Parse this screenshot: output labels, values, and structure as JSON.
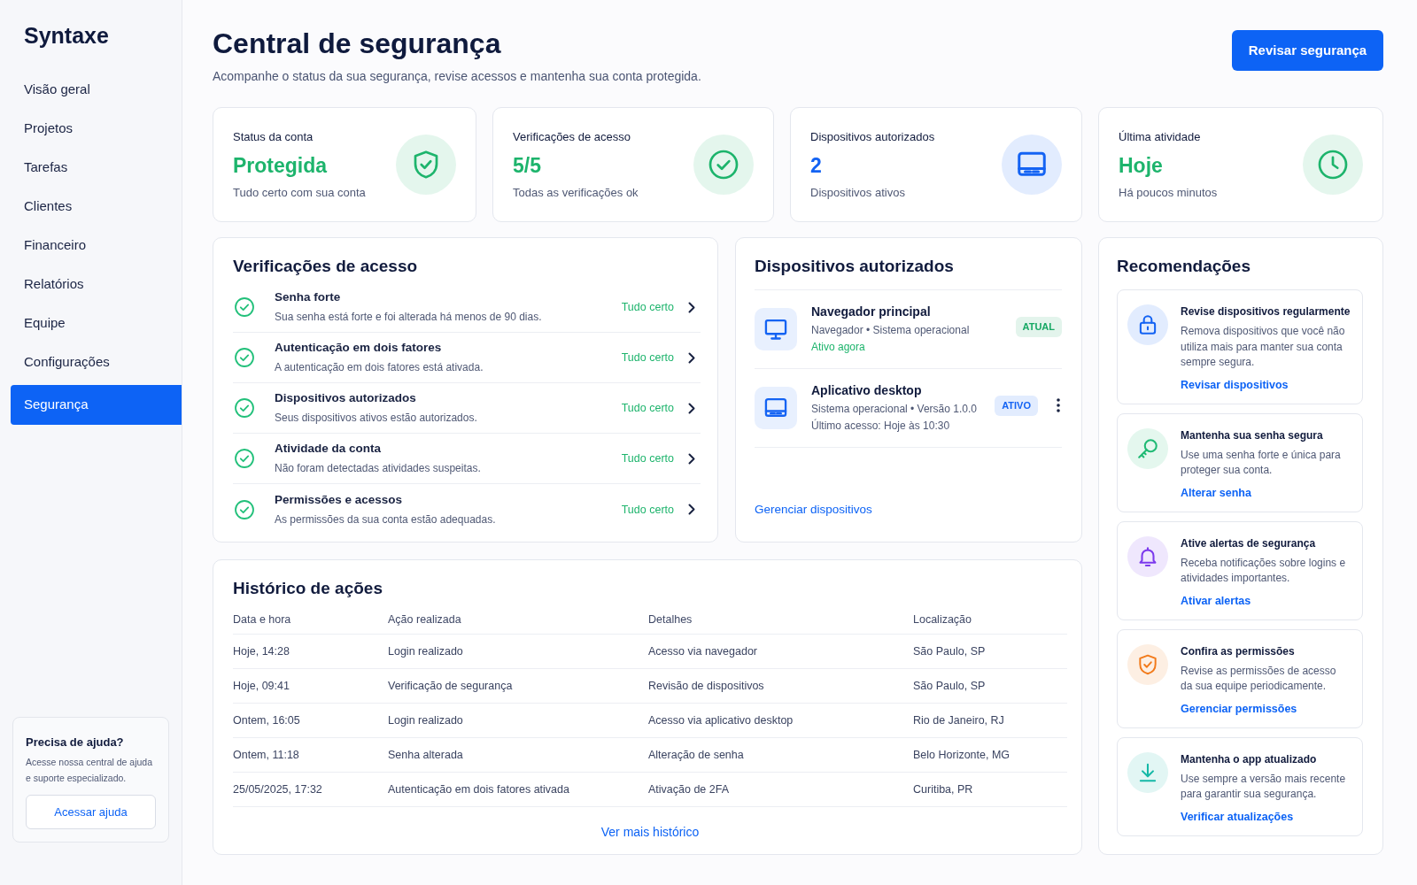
{
  "sidebar": {
    "logo": "Syntaxe",
    "items": [
      {
        "label": "Visão geral",
        "selected": false
      },
      {
        "label": "Projetos",
        "selected": false
      },
      {
        "label": "Tarefas",
        "selected": false
      },
      {
        "label": "Clientes",
        "selected": false
      },
      {
        "label": "Financeiro",
        "selected": false
      },
      {
        "label": "Relatórios",
        "selected": false
      },
      {
        "label": "Equipe",
        "selected": false
      },
      {
        "label": "Configurações",
        "selected": false
      },
      {
        "label": "Segurança",
        "selected": true
      }
    ],
    "help": {
      "title": "Precisa de ajuda?",
      "text": "Acesse nossa central de ajuda e suporte especializado.",
      "button": "Acessar ajuda"
    }
  },
  "header": {
    "title": "Central de segurança",
    "subtitle": "Acompanhe o status da sua segurança, revise acessos e mantenha sua conta protegida.",
    "button": "Revisar segurança"
  },
  "stats": [
    {
      "kind": "status",
      "label": "Status da conta",
      "value": "Protegida",
      "caption": "Tudo certo com sua conta",
      "color": "#1db46c"
    },
    {
      "kind": "checks",
      "label": "Verificações de acesso",
      "value": "5/5",
      "caption": "Todas as verificações ok",
      "color": "#1db46c"
    },
    {
      "kind": "devices",
      "label": "Dispositivos autorizados",
      "value": "2",
      "caption": "Dispositivos ativos",
      "color": "#1463f3"
    },
    {
      "kind": "activity",
      "label": "Última atividade",
      "value": "Hoje",
      "caption": "Há poucos minutos",
      "color": "#1db46c"
    }
  ],
  "access_checks": {
    "title": "Verificações de acesso",
    "items": [
      {
        "title": "Senha forte",
        "description": "Sua senha está forte e foi alterada há menos de 90 dias.",
        "status": "Tudo certo",
        "ok": true
      },
      {
        "title": "Autenticação em dois fatores",
        "description": "A autenticação em dois fatores está ativada.",
        "status": "Tudo certo",
        "ok": true
      },
      {
        "title": "Dispositivos autorizados",
        "description": "Seus dispositivos ativos estão autorizados.",
        "status": "Tudo certo",
        "ok": true
      },
      {
        "title": "Atividade da conta",
        "description": "Não foram detectadas atividades suspeitas.",
        "status": "Tudo certo",
        "ok": true
      },
      {
        "title": "Permissões e acessos",
        "description": "As permissões da sua conta estão adequadas.",
        "status": "Tudo certo",
        "ok": true
      }
    ]
  },
  "devices": {
    "title": "Dispositivos autorizados",
    "items": [
      {
        "kind": "browser",
        "name": "Navegador principal",
        "details": "Navegador • Sistema operacional",
        "status": {
          "text": "Ativo agora",
          "online": true
        },
        "badge": {
          "text": "ATUAL",
          "color": "#16a864"
        },
        "menu": false
      },
      {
        "kind": "desktop",
        "name": "Aplicativo desktop",
        "details": "Sistema operacional • Versão 1.0.0",
        "status": {
          "text": "Último acesso: Hoje às 10:30",
          "online": false
        },
        "badge": {
          "text": "ATIVO",
          "color": "#1463f3"
        },
        "menu": true
      }
    ],
    "link": "Gerenciar dispositivos"
  },
  "history": {
    "title": "Histórico de ações",
    "columns": [
      "Data e hora",
      "Ação realizada",
      "Detalhes",
      "Localização"
    ],
    "rows": [
      [
        "Hoje, 14:28",
        "Login realizado",
        "Acesso via navegador",
        "São Paulo, SP"
      ],
      [
        "Hoje, 09:41",
        "Verificação de segurança",
        "Revisão de dispositivos",
        "São Paulo, SP"
      ],
      [
        "Ontem, 16:05",
        "Login realizado",
        "Acesso via aplicativo desktop",
        "Rio de Janeiro, RJ"
      ],
      [
        "Ontem, 11:18",
        "Senha alterada",
        "Alteração de senha",
        "Belo Horizonte, MG"
      ],
      [
        "25/05/2025, 17:32",
        "Autenticação em dois fatores ativada",
        "Ativação de 2FA",
        "Curitiba, PR"
      ]
    ],
    "link": "Ver mais histórico"
  },
  "recommendations": {
    "title": "Recomendações",
    "items": [
      {
        "kind": "devices",
        "title": "Revise dispositivos regularmente",
        "text": "Remova dispositivos que você não utiliza mais para manter sua conta sempre segura.",
        "link": "Revisar dispositivos",
        "color": "#1463f3"
      },
      {
        "kind": "password",
        "title": "Mantenha sua senha segura",
        "text": "Use uma senha forte e única para proteger sua conta.",
        "link": "Alterar senha",
        "color": "#1fba74"
      },
      {
        "kind": "alerts",
        "title": "Ative alertas de segurança",
        "text": "Receba notificações sobre logins e atividades importantes.",
        "link": "Ativar alertas",
        "color": "#7c3aed"
      },
      {
        "kind": "permissions",
        "title": "Confira as permissões",
        "text": "Revise as permissões de acesso da sua equipe periodicamente.",
        "link": "Gerenciar permissões",
        "color": "#f27a1a"
      },
      {
        "kind": "updates",
        "title": "Mantenha o app atualizado",
        "text": "Use sempre a versão mais recente para garantir sua segurança.",
        "link": "Verificar atualizações",
        "color": "#14b8a6"
      }
    ]
  }
}
